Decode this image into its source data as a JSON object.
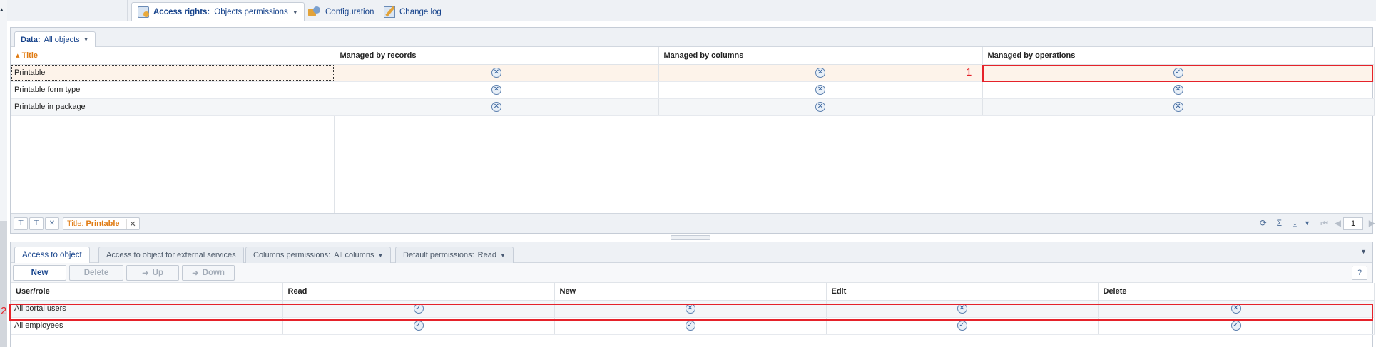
{
  "top_tabs": {
    "access_rights_label": "Access rights:",
    "access_rights_value": "Objects permissions",
    "configuration": "Configuration",
    "change_log": "Change log"
  },
  "data_filter": {
    "label": "Data:",
    "value": "All objects"
  },
  "objects_grid": {
    "columns": [
      "Title",
      "Managed by records",
      "Managed by columns",
      "Managed by operations"
    ],
    "rows": [
      {
        "title": "Printable",
        "records": "✕",
        "columns": "✕",
        "operations": "✓"
      },
      {
        "title": "Printable form type",
        "records": "✕",
        "columns": "✕",
        "operations": "✕"
      },
      {
        "title": "Printable in package",
        "records": "✕",
        "columns": "✕",
        "operations": "✕"
      }
    ]
  },
  "filter_chip": {
    "label": "Title:",
    "value": "Printable"
  },
  "pager": {
    "page": "1"
  },
  "bottom_tabs": {
    "access_to_object": "Access to object",
    "external": "Access to object for external services",
    "columns_label": "Columns permissions:",
    "columns_value": "All columns",
    "default_label": "Default permissions:",
    "default_value": "Read"
  },
  "toolbar": {
    "new": "New",
    "delete": "Delete",
    "up": "Up",
    "down": "Down",
    "help": "?"
  },
  "roles_grid": {
    "columns": [
      "User/role",
      "Read",
      "New",
      "Edit",
      "Delete"
    ],
    "rows": [
      {
        "role": "All portal users",
        "read": "✓",
        "new": "✕",
        "edit": "✕",
        "delete": "✕"
      },
      {
        "role": "All employees",
        "read": "✓",
        "new": "✓",
        "edit": "✓",
        "delete": "✓"
      }
    ]
  },
  "annotations": {
    "one": "1",
    "two": "2"
  },
  "colors": {
    "highlight": "#e5222a",
    "accent": "#e07b12",
    "link": "#15428b"
  }
}
